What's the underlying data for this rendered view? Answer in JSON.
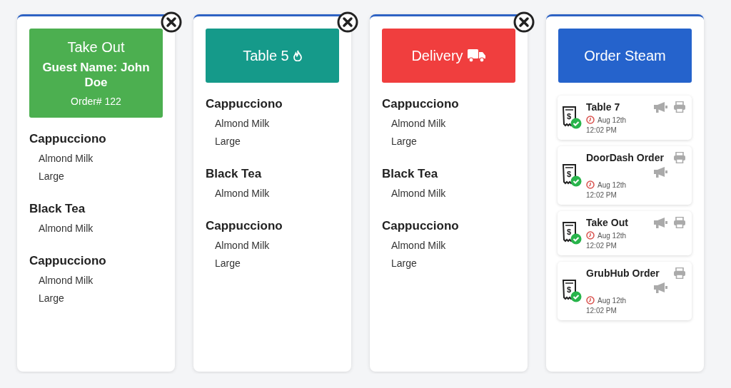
{
  "tickets": [
    {
      "kind": "takeout",
      "title": "Take Out",
      "guest": "Guest Name: John Doe",
      "order_no": "Order# 122",
      "color": "#4caf50",
      "closable": true,
      "items": [
        {
          "name": "Cappucciono",
          "options": [
            "Almond Milk",
            "Large"
          ]
        },
        {
          "name": "Black Tea",
          "options": [
            "Almond Milk"
          ]
        },
        {
          "name": "Cappucciono",
          "options": [
            "Almond Milk",
            "Large"
          ]
        }
      ]
    },
    {
      "kind": "table",
      "title": "Table 5",
      "color": "#159a8a",
      "closable": true,
      "items": [
        {
          "name": "Cappucciono",
          "options": [
            "Almond Milk",
            "Large"
          ]
        },
        {
          "name": "Black Tea",
          "options": [
            "Almond Milk"
          ]
        },
        {
          "name": "Cappucciono",
          "options": [
            "Almond Milk",
            "Large"
          ]
        }
      ]
    },
    {
      "kind": "delivery",
      "title": "Delivery",
      "color": "#f03e3e",
      "closable": true,
      "items": [
        {
          "name": "Cappucciono",
          "options": [
            "Almond Milk",
            "Large"
          ]
        },
        {
          "name": "Black Tea",
          "options": [
            "Almond Milk"
          ]
        },
        {
          "name": "Cappucciono",
          "options": [
            "Almond Milk",
            "Large"
          ]
        }
      ]
    }
  ],
  "stream": {
    "title": "Order Steam",
    "orders": [
      {
        "kind": "inline",
        "receipt_mark": "$",
        "title": "Table 7",
        "date": "Aug 12th",
        "time": "12:02 PM"
      },
      {
        "kind": "stacked",
        "receipt_mark": "$",
        "title": "DoorDash Order",
        "date": "Aug 12th",
        "time": "12:02 PM"
      },
      {
        "kind": "inline",
        "receipt_mark": "$",
        "title": "Take Out",
        "date": "Aug 12th",
        "time": "12:02 PM"
      },
      {
        "kind": "stacked",
        "receipt_mark": "$",
        "title": "GrubHub Order",
        "date": "Aug 12th",
        "time": "12:02 PM"
      }
    ]
  }
}
